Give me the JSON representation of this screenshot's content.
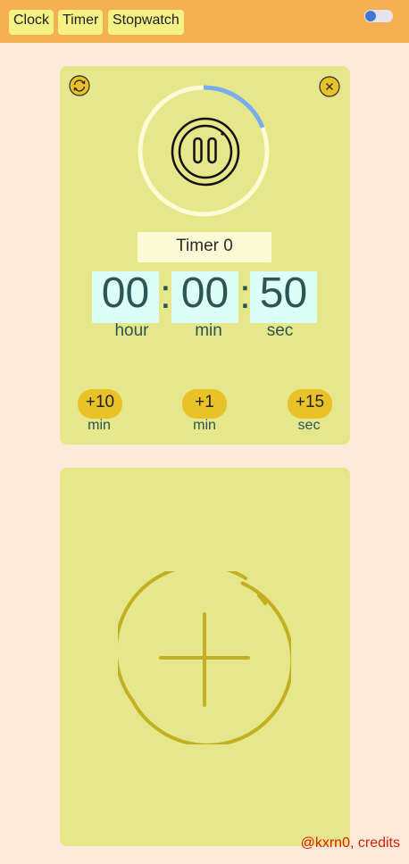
{
  "nav": {
    "tabs": [
      "Clock",
      "Timer",
      "Stopwatch"
    ]
  },
  "theme_toggle": {
    "state": "off",
    "knob_color": "#3f7ad0"
  },
  "timer_card": {
    "reset_icon": "reset-icon",
    "close_icon": "close-icon",
    "progress_fraction": 0.19,
    "play_state_icon": "pause-icon",
    "name": "Timer 0",
    "hours": "00",
    "minutes": "00",
    "seconds": "50",
    "separator": ":",
    "units": {
      "hour": "hour",
      "min": "min",
      "sec": "sec"
    },
    "quick_add": [
      {
        "label": "+10",
        "unit": "min"
      },
      {
        "label": "+1",
        "unit": "min"
      },
      {
        "label": "+15",
        "unit": "sec"
      }
    ]
  },
  "add_card": {
    "icon": "add-timer-icon"
  },
  "footer": {
    "credits": "@kxrn0, credits"
  },
  "colors": {
    "topbar": "#f5b051",
    "background": "#fcebd9",
    "card": "#e6e68a",
    "accent_button": "#e8c227",
    "progress": "#7aaeea",
    "digit_box": "#dcfff8",
    "credits": "#e11a0a"
  }
}
